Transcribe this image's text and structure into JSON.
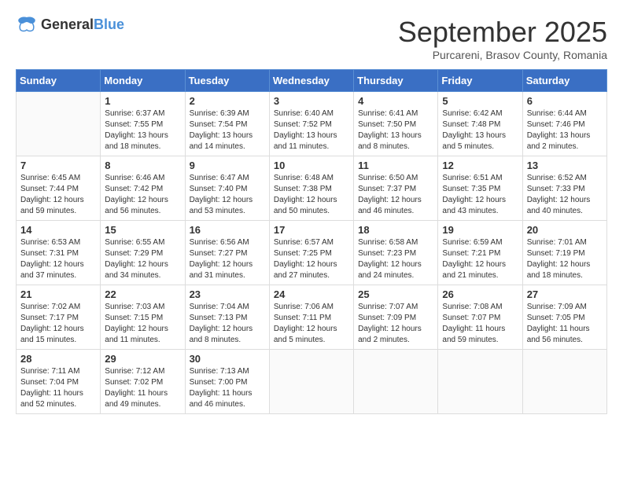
{
  "header": {
    "logo_general": "General",
    "logo_blue": "Blue",
    "title": "September 2025",
    "location": "Purcareni, Brasov County, Romania"
  },
  "weekdays": [
    "Sunday",
    "Monday",
    "Tuesday",
    "Wednesday",
    "Thursday",
    "Friday",
    "Saturday"
  ],
  "weeks": [
    [
      {
        "day": "",
        "info": ""
      },
      {
        "day": "1",
        "info": "Sunrise: 6:37 AM\nSunset: 7:55 PM\nDaylight: 13 hours\nand 18 minutes."
      },
      {
        "day": "2",
        "info": "Sunrise: 6:39 AM\nSunset: 7:54 PM\nDaylight: 13 hours\nand 14 minutes."
      },
      {
        "day": "3",
        "info": "Sunrise: 6:40 AM\nSunset: 7:52 PM\nDaylight: 13 hours\nand 11 minutes."
      },
      {
        "day": "4",
        "info": "Sunrise: 6:41 AM\nSunset: 7:50 PM\nDaylight: 13 hours\nand 8 minutes."
      },
      {
        "day": "5",
        "info": "Sunrise: 6:42 AM\nSunset: 7:48 PM\nDaylight: 13 hours\nand 5 minutes."
      },
      {
        "day": "6",
        "info": "Sunrise: 6:44 AM\nSunset: 7:46 PM\nDaylight: 13 hours\nand 2 minutes."
      }
    ],
    [
      {
        "day": "7",
        "info": "Sunrise: 6:45 AM\nSunset: 7:44 PM\nDaylight: 12 hours\nand 59 minutes."
      },
      {
        "day": "8",
        "info": "Sunrise: 6:46 AM\nSunset: 7:42 PM\nDaylight: 12 hours\nand 56 minutes."
      },
      {
        "day": "9",
        "info": "Sunrise: 6:47 AM\nSunset: 7:40 PM\nDaylight: 12 hours\nand 53 minutes."
      },
      {
        "day": "10",
        "info": "Sunrise: 6:48 AM\nSunset: 7:38 PM\nDaylight: 12 hours\nand 50 minutes."
      },
      {
        "day": "11",
        "info": "Sunrise: 6:50 AM\nSunset: 7:37 PM\nDaylight: 12 hours\nand 46 minutes."
      },
      {
        "day": "12",
        "info": "Sunrise: 6:51 AM\nSunset: 7:35 PM\nDaylight: 12 hours\nand 43 minutes."
      },
      {
        "day": "13",
        "info": "Sunrise: 6:52 AM\nSunset: 7:33 PM\nDaylight: 12 hours\nand 40 minutes."
      }
    ],
    [
      {
        "day": "14",
        "info": "Sunrise: 6:53 AM\nSunset: 7:31 PM\nDaylight: 12 hours\nand 37 minutes."
      },
      {
        "day": "15",
        "info": "Sunrise: 6:55 AM\nSunset: 7:29 PM\nDaylight: 12 hours\nand 34 minutes."
      },
      {
        "day": "16",
        "info": "Sunrise: 6:56 AM\nSunset: 7:27 PM\nDaylight: 12 hours\nand 31 minutes."
      },
      {
        "day": "17",
        "info": "Sunrise: 6:57 AM\nSunset: 7:25 PM\nDaylight: 12 hours\nand 27 minutes."
      },
      {
        "day": "18",
        "info": "Sunrise: 6:58 AM\nSunset: 7:23 PM\nDaylight: 12 hours\nand 24 minutes."
      },
      {
        "day": "19",
        "info": "Sunrise: 6:59 AM\nSunset: 7:21 PM\nDaylight: 12 hours\nand 21 minutes."
      },
      {
        "day": "20",
        "info": "Sunrise: 7:01 AM\nSunset: 7:19 PM\nDaylight: 12 hours\nand 18 minutes."
      }
    ],
    [
      {
        "day": "21",
        "info": "Sunrise: 7:02 AM\nSunset: 7:17 PM\nDaylight: 12 hours\nand 15 minutes."
      },
      {
        "day": "22",
        "info": "Sunrise: 7:03 AM\nSunset: 7:15 PM\nDaylight: 12 hours\nand 11 minutes."
      },
      {
        "day": "23",
        "info": "Sunrise: 7:04 AM\nSunset: 7:13 PM\nDaylight: 12 hours\nand 8 minutes."
      },
      {
        "day": "24",
        "info": "Sunrise: 7:06 AM\nSunset: 7:11 PM\nDaylight: 12 hours\nand 5 minutes."
      },
      {
        "day": "25",
        "info": "Sunrise: 7:07 AM\nSunset: 7:09 PM\nDaylight: 12 hours\nand 2 minutes."
      },
      {
        "day": "26",
        "info": "Sunrise: 7:08 AM\nSunset: 7:07 PM\nDaylight: 11 hours\nand 59 minutes."
      },
      {
        "day": "27",
        "info": "Sunrise: 7:09 AM\nSunset: 7:05 PM\nDaylight: 11 hours\nand 56 minutes."
      }
    ],
    [
      {
        "day": "28",
        "info": "Sunrise: 7:11 AM\nSunset: 7:04 PM\nDaylight: 11 hours\nand 52 minutes."
      },
      {
        "day": "29",
        "info": "Sunrise: 7:12 AM\nSunset: 7:02 PM\nDaylight: 11 hours\nand 49 minutes."
      },
      {
        "day": "30",
        "info": "Sunrise: 7:13 AM\nSunset: 7:00 PM\nDaylight: 11 hours\nand 46 minutes."
      },
      {
        "day": "",
        "info": ""
      },
      {
        "day": "",
        "info": ""
      },
      {
        "day": "",
        "info": ""
      },
      {
        "day": "",
        "info": ""
      }
    ]
  ]
}
